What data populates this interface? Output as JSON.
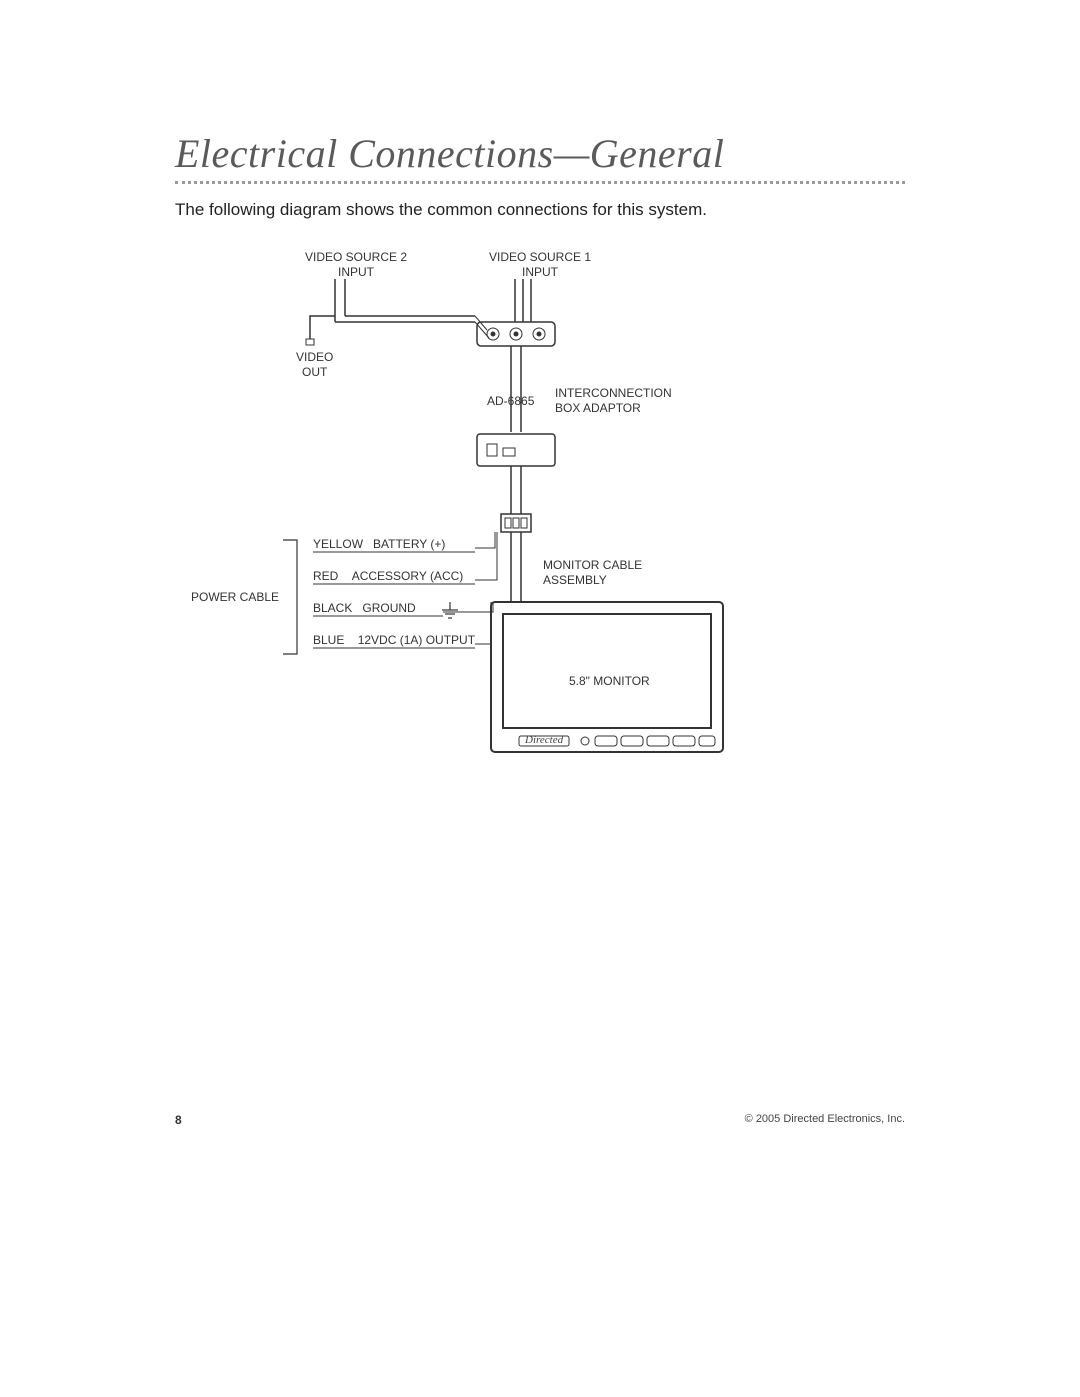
{
  "heading": "Electrical Connections—General",
  "intro": "The following diagram shows the common connections for this system.",
  "labels": {
    "video_source_2_line1": "VIDEO SOURCE 2",
    "video_source_2_line2": "INPUT",
    "video_source_1_line1": "VIDEO SOURCE 1",
    "video_source_1_line2": "INPUT",
    "video_out_line1": "VIDEO",
    "video_out_line2": "OUT",
    "adaptor_model": "AD-6865",
    "adaptor_line1": "INTERCONNECTION",
    "adaptor_line2": "BOX ADAPTOR",
    "monitor_cable_line1": "MONITOR CABLE",
    "monitor_cable_line2": "ASSEMBLY",
    "monitor_size": "5.8\" MONITOR",
    "monitor_brand": "Directed",
    "power_cable": "POWER CABLE"
  },
  "wires": [
    {
      "color": "YELLOW",
      "desc": "BATTERY (+)"
    },
    {
      "color": "RED",
      "desc": "ACCESSORY (ACC)"
    },
    {
      "color": "BLACK",
      "desc": "GROUND"
    },
    {
      "color": "BLUE",
      "desc": "12VDC (1A) OUTPUT"
    }
  ],
  "footer": {
    "page": "8",
    "copyright": "© 2005 Directed Electronics, Inc."
  }
}
